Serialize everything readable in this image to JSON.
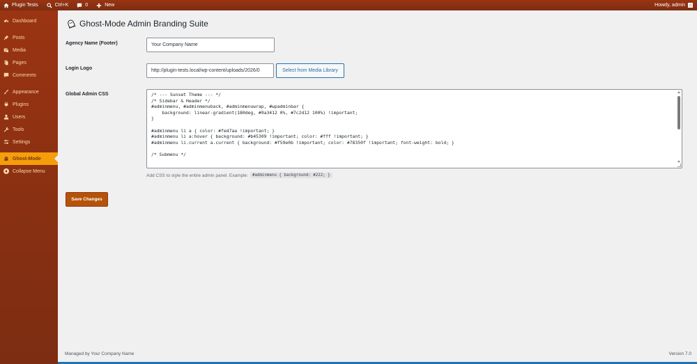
{
  "adminbar": {
    "site_name": "Plugin Tests",
    "search_shortcut": "Ctrl+K",
    "comments_count": "0",
    "new_label": "New",
    "howdy": "Howdy, admin"
  },
  "sidebar": {
    "items": [
      {
        "label": "Dashboard",
        "icon": "dashboard-icon"
      },
      {
        "label": "Posts",
        "icon": "pin-icon"
      },
      {
        "label": "Media",
        "icon": "media-icon"
      },
      {
        "label": "Pages",
        "icon": "pages-icon"
      },
      {
        "label": "Comments",
        "icon": "comment-icon"
      },
      {
        "label": "Appearance",
        "icon": "brush-icon"
      },
      {
        "label": "Plugins",
        "icon": "plugin-icon"
      },
      {
        "label": "Users",
        "icon": "user-icon"
      },
      {
        "label": "Tools",
        "icon": "wrench-icon"
      },
      {
        "label": "Settings",
        "icon": "settings-icon"
      },
      {
        "label": "Ghost-Mode",
        "icon": "ghost-icon"
      },
      {
        "label": "Collapse Menu",
        "icon": "collapse-icon"
      }
    ],
    "current": "Ghost-Mode"
  },
  "page": {
    "title": "Ghost-Mode Admin Branding Suite",
    "agency_label": "Agency Name (Footer)",
    "agency_value": "Your Company Name",
    "logo_label": "Login Logo",
    "logo_value": "http://plugin-tests.local/wp-content/uploads/2026/0",
    "logo_button": "Select from Media Library",
    "css_label": "Global Admin CSS",
    "css_value": "/* --- Sunset Theme --- */\n/* Sidebar & Header */\n#adminmenu, #adminmenuback, #adminmenuwrap, #wpadminbar {\n    background: linear-gradient(180deg, #9a3412 0%, #7c2d12 100%) !important;\n}\n\n#adminmenu li a { color: #fed7aa !important; }\n#adminmenu li a:hover { background: #b45309 !important; color: #fff !important; }\n#adminmenu li.current a.current { background: #f59e0b !important; color: #78350f !important; font-weight: bold; }\n\n/* Submenu */",
    "css_help": "Add CSS to style the entire admin panel. Example:",
    "css_help_code": "#adminmenu { background: #222; }",
    "save_button": "Save Changes"
  },
  "footer": {
    "left": "Managed by Your Company Name",
    "right": "Version 7.0"
  },
  "colors": {
    "sidebar_gradient_start": "#9a3412",
    "sidebar_gradient_end": "#7c2d12",
    "menu_text": "#fed7aa",
    "current_bg": "#f59e0b",
    "current_text": "#78350f",
    "primary_button": "#b45309"
  }
}
